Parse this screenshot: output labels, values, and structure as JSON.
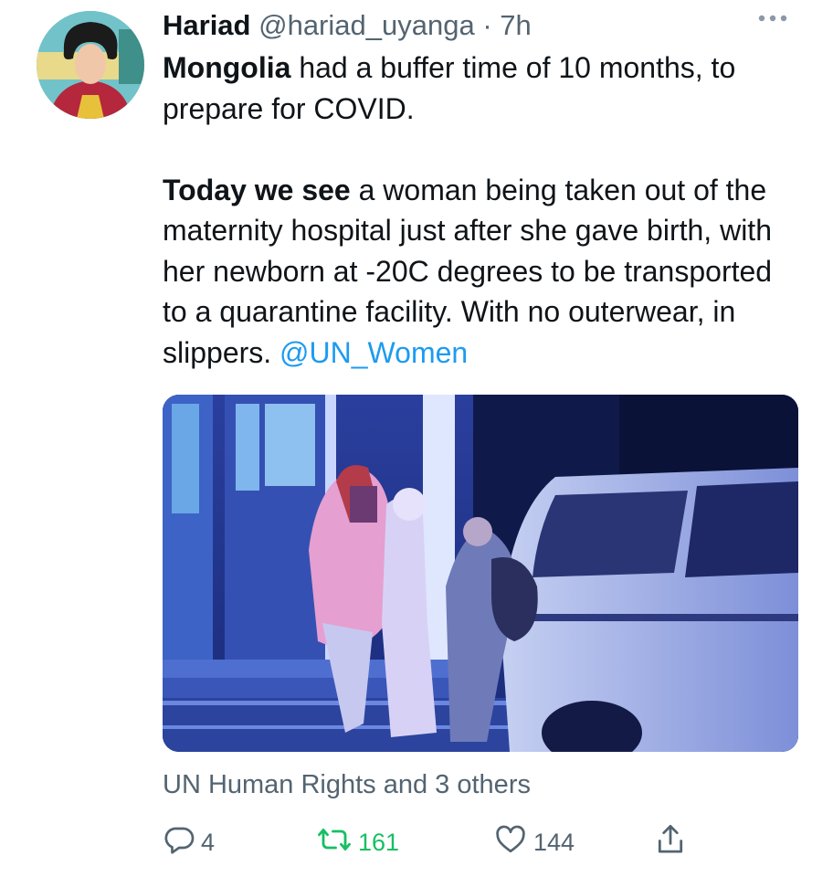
{
  "tweet": {
    "author_name": "Hariad",
    "author_handle": "@hariad_uyanga",
    "separator": "·",
    "time": "7h",
    "text_p1_bold": "Mongolia",
    "text_p1_rest": " had a buffer time of 10 months, to prepare for COVID.",
    "text_p2_bold": "Today we see",
    "text_p2_rest": " a woman being taken out of the maternity hospital just after she gave birth, with her newborn at -20C degrees to be transported to a quarantine facility. With no outerwear, in slippers. ",
    "mention": "@UN_Women",
    "tagged": "UN Human Rights and 3 others",
    "icons": {
      "more": "more-horizontal-icon",
      "reply": "reply-icon",
      "retweet": "retweet-icon",
      "like": "like-icon",
      "share": "share-icon"
    }
  },
  "metrics": {
    "replies": "4",
    "retweets": "161",
    "likes": "144"
  },
  "colors": {
    "accent": "#1d9bf0",
    "retweet": "#17bf63",
    "secondary_text": "#536471"
  }
}
